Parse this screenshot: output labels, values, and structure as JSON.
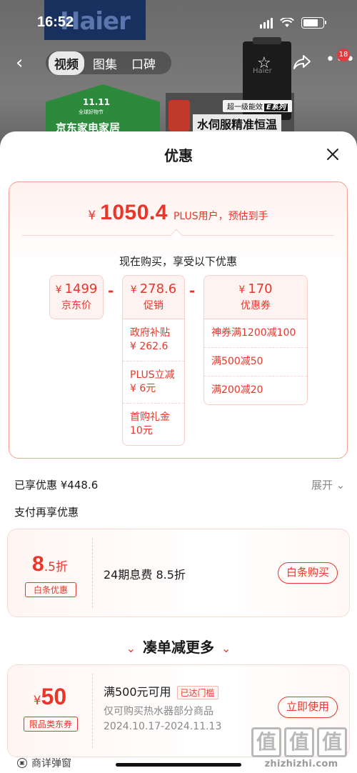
{
  "status_bar": {
    "time": "16:52"
  },
  "background_page": {
    "brand_text": "Haier",
    "product_label": "Haier",
    "banner_title": "11.11",
    "banner_sub": "全球好物节",
    "banner_name": "京东家电家居",
    "badge_text": "超一级能效",
    "badge_series": "E系列",
    "slogan": "水伺服精准恒温"
  },
  "nav": {
    "tabs": [
      {
        "label": "视频"
      },
      {
        "label": "图集"
      },
      {
        "label": "口碑"
      }
    ],
    "active_tab": "视频",
    "badge_count": "18"
  },
  "sheet": {
    "title": "优惠",
    "summary": {
      "currency": "¥",
      "amount": "1050.4",
      "note": "PLUS用户，预估到手",
      "subtitle": "现在购买，享受以下优惠"
    },
    "breakdown": {
      "jd_price": {
        "currency": "¥",
        "value": "1499",
        "label": "京东价"
      },
      "promotion": {
        "currency": "¥",
        "value": "278.6",
        "label": "促销",
        "items": [
          "政府补贴 ¥ 262.6",
          "PLUS立减 ¥ 6元",
          "首购礼金 10元"
        ]
      },
      "coupon": {
        "currency": "¥",
        "value": "170",
        "label": "优惠券",
        "items": [
          "神券满1200减100",
          "满500减50",
          "满200减20"
        ]
      },
      "minus_sign": "-"
    },
    "applied": {
      "label": "已享优惠 ¥448.6",
      "expand": "展开"
    },
    "pay_title": "支付再享优惠",
    "baitiao": {
      "discount_big": "8",
      "discount_small": ".5折",
      "tag": "白条优惠",
      "desc": "24期息费 8.5折",
      "button": "白条购买"
    },
    "more": {
      "title": "凑单减更多",
      "chevron": "⌄"
    },
    "coupon_card": {
      "currency": "¥",
      "value": "50",
      "tag": "限品类东券",
      "condition": "满500元可用",
      "status": "已达门槛",
      "scope": "仅可购买热水器部分商品",
      "validity": "2024.10.17-2024.11.13",
      "button": "立即使用"
    },
    "footer": {
      "popup_label": "商详弹窗"
    }
  },
  "watermark": {
    "glyphs": [
      "值",
      "值",
      "值"
    ],
    "url": "zhizhizhi.com"
  },
  "colors": {
    "accent": "#e8372a",
    "border": "#f6a08e",
    "pill_bg": "#fff3f1"
  }
}
